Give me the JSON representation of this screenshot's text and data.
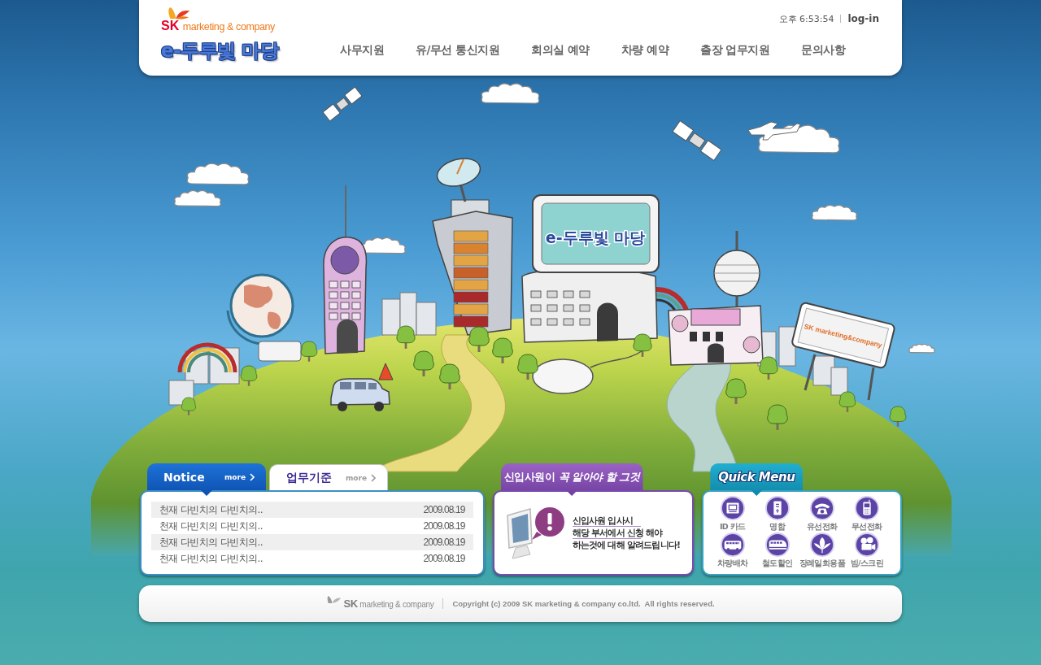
{
  "header": {
    "brand": {
      "mark": "SK",
      "name": "marketing & company"
    },
    "site_title": "e-두루빛 마당",
    "clock": "오후 6:53:54",
    "login": "log-in"
  },
  "nav": [
    "사무지원",
    "유/무선 통신지원",
    "회의실 예약",
    "차량 예약",
    "출장 업무지원",
    "문의사항"
  ],
  "hero": {
    "billboard_text": "e-두루빛 마당",
    "sign_text": "SK marketing&company"
  },
  "notice_panel": {
    "tabs": [
      {
        "label": "Notice",
        "more": "more",
        "selected": true
      },
      {
        "label": "업무기준",
        "more": "more",
        "selected": false
      }
    ],
    "rows": [
      {
        "title": "천재 다빈치의 다빈치의..",
        "date": "2009.08.19"
      },
      {
        "title": "천재 다빈치의 다빈치의..",
        "date": "2009.08.19"
      },
      {
        "title": "천재 다빈치의 다빈치의..",
        "date": "2009.08.19"
      },
      {
        "title": "천재 다빈치의 다빈치의..",
        "date": "2009.08.19"
      }
    ]
  },
  "newcomer_panel": {
    "title": "신입사원이 *꼭 알아야 할 그것*",
    "message": "신입사원 입사시\n해당 부서에서 신청 해야\n하는것에 대해 알려드립니다!"
  },
  "quick_menu": {
    "title": "Quick Menu",
    "items": [
      {
        "label": "ID 카드",
        "kind": "id_card"
      },
      {
        "label": "명함",
        "kind": "name_card"
      },
      {
        "label": "유선전화",
        "kind": "desk_phone"
      },
      {
        "label": "무선전화",
        "kind": "mobile_phone"
      },
      {
        "label": "차량배차",
        "kind": "bus"
      },
      {
        "label": "철도할인",
        "kind": "train"
      },
      {
        "label": "장례일회용품",
        "kind": "leaf"
      },
      {
        "label": "빔/스크린",
        "kind": "projector"
      }
    ]
  },
  "footer": {
    "brand": {
      "mark": "SK",
      "name": "marketing & company"
    },
    "copyright": "Copyright (c) 2009 SK marketing & company co.ltd.  All rights reserved."
  }
}
